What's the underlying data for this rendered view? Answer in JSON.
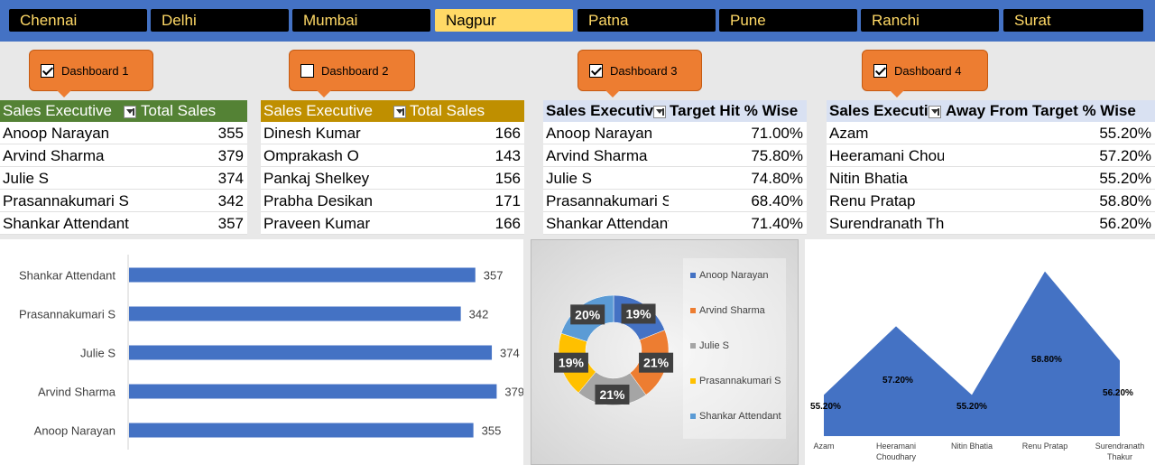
{
  "cities": [
    "Chennai",
    "Delhi",
    "Mumbai",
    "Nagpur",
    "Patna",
    "Pune",
    "Ranchi",
    "Surat"
  ],
  "active_city": "Nagpur",
  "dashboards": [
    {
      "label": "Dashboard 1",
      "checked": true
    },
    {
      "label": "Dashboard 2",
      "checked": false
    },
    {
      "label": "Dashboard 3",
      "checked": true
    },
    {
      "label": "Dashboard 4",
      "checked": true
    }
  ],
  "tables": [
    {
      "col1": "Sales Executive",
      "col2": "Total Sales",
      "color": "#548235",
      "rows": [
        {
          "name": "Anoop Narayan",
          "value": "355"
        },
        {
          "name": "Arvind Sharma",
          "value": "379"
        },
        {
          "name": "Julie S",
          "value": "374"
        },
        {
          "name": "Prasannakumari S",
          "value": "342"
        },
        {
          "name": "Shankar Attendant",
          "value": "357"
        }
      ]
    },
    {
      "col1": "Sales Executive",
      "col2": "Total Sales",
      "color": "#bf8f00",
      "rows": [
        {
          "name": "Dinesh Kumar",
          "value": "166"
        },
        {
          "name": "Omprakash O",
          "value": "143"
        },
        {
          "name": "Pankaj Shelkey",
          "value": "156"
        },
        {
          "name": "Prabha Desikan",
          "value": "171"
        },
        {
          "name": "Praveen Kumar",
          "value": "166"
        }
      ]
    },
    {
      "col1": "Sales Executive",
      "col2": "Target Hit % Wise",
      "color": "#d9e1f2",
      "rows": [
        {
          "name": "Anoop Narayan",
          "value": "71.00%"
        },
        {
          "name": "Arvind Sharma",
          "value": "75.80%"
        },
        {
          "name": "Julie S",
          "value": "74.80%"
        },
        {
          "name": "Prasannakumari S",
          "value": "68.40%"
        },
        {
          "name": "Shankar Attendant",
          "value": "71.40%"
        }
      ]
    },
    {
      "col1": "Sales Executive",
      "col2": "Away From Target % Wise",
      "color": "#d9e1f2",
      "rows": [
        {
          "name": "Azam",
          "value": "55.20%"
        },
        {
          "name": "Heeramani Choudhary",
          "value": "57.20%"
        },
        {
          "name": "Nitin Bhatia",
          "value": "55.20%"
        },
        {
          "name": "Renu Pratap",
          "value": "58.80%"
        },
        {
          "name": "Surendranath Thakur",
          "value": "56.20%"
        }
      ]
    }
  ],
  "chart_data": [
    {
      "type": "bar",
      "orientation": "horizontal",
      "categories": [
        "Anoop Narayan",
        "Arvind Sharma",
        "Julie S",
        "Prasannakumari S",
        "Shankar Attendant"
      ],
      "values": [
        355,
        379,
        374,
        342,
        357
      ],
      "data_labels": [
        "355",
        "379",
        "374",
        "342",
        "357"
      ],
      "xlim": [
        0,
        400
      ],
      "color": "#4472c4",
      "grid": false
    },
    {
      "type": "pie",
      "style": "doughnut",
      "categories": [
        "Anoop Narayan",
        "Arvind Sharma",
        "Julie S",
        "Prasannakumari S",
        "Shankar Attendant"
      ],
      "values": [
        19,
        21,
        21,
        19,
        20
      ],
      "data_labels": [
        "19%",
        "21%",
        "21%",
        "19%",
        "20%"
      ],
      "colors": [
        "#4472c4",
        "#ed7d31",
        "#a5a5a5",
        "#ffc000",
        "#5b9bd5"
      ],
      "legend": "right"
    },
    {
      "type": "area",
      "categories": [
        "Azam",
        "Heeramani Choudhary",
        "Nitin Bhatia",
        "Renu Pratap",
        "Surendranath Thakur"
      ],
      "values": [
        55.2,
        57.2,
        55.2,
        58.8,
        56.2
      ],
      "data_labels": [
        "55.20%",
        "57.20%",
        "55.20%",
        "58.80%",
        "56.20%"
      ],
      "ylim": [
        54,
        59
      ],
      "color": "#4472c4",
      "grid": false
    }
  ]
}
